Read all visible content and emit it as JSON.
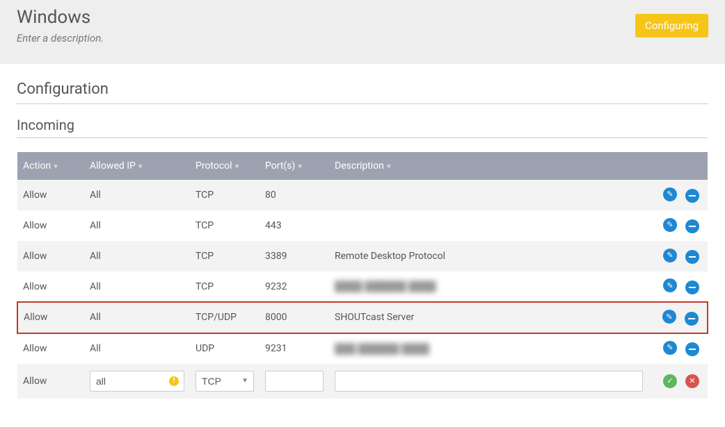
{
  "header": {
    "title": "Windows",
    "subtitle": "Enter a description.",
    "status": "Configuring"
  },
  "configuration": {
    "title": "Configuration",
    "incoming": {
      "title": "Incoming",
      "columns": {
        "action": "Action",
        "allowed_ip": "Allowed IP",
        "protocol": "Protocol",
        "ports": "Port(s)",
        "description": "Description"
      },
      "rows": [
        {
          "action": "Allow",
          "allowed_ip": "All",
          "protocol": "TCP",
          "ports": "80",
          "description": "",
          "highlight": false
        },
        {
          "action": "Allow",
          "allowed_ip": "All",
          "protocol": "TCP",
          "ports": "443",
          "description": "",
          "highlight": false
        },
        {
          "action": "Allow",
          "allowed_ip": "All",
          "protocol": "TCP",
          "ports": "3389",
          "description": "Remote Desktop Protocol",
          "highlight": false
        },
        {
          "action": "Allow",
          "allowed_ip": "All",
          "protocol": "TCP",
          "ports": "9232",
          "description": "████ ██████ ████",
          "blurred": true,
          "highlight": false
        },
        {
          "action": "Allow",
          "allowed_ip": "All",
          "protocol": "TCP/UDP",
          "ports": "8000",
          "description": "SHOUTcast Server",
          "highlight": true
        },
        {
          "action": "Allow",
          "allowed_ip": "All",
          "protocol": "UDP",
          "ports": "9231",
          "description": "███ ██████ ████",
          "blurred": true,
          "highlight": false
        }
      ],
      "new_row": {
        "action": "Allow",
        "allowed_ip_value": "all",
        "protocol_value": "TCP",
        "ports_value": "",
        "description_value": ""
      }
    }
  },
  "icons": {
    "edit": "✎",
    "remove": "−",
    "confirm": "✓",
    "cancel": "✕",
    "warn": "!",
    "caret": "▼"
  }
}
